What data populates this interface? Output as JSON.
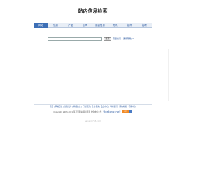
{
  "page": {
    "title": "站内信息检索"
  },
  "nav": {
    "items": [
      {
        "label": "网站",
        "active": true
      },
      {
        "label": "信息",
        "active": false
      },
      {
        "label": "产品",
        "active": false
      },
      {
        "label": "公司",
        "active": false
      },
      {
        "label": "展会信息",
        "active": false
      },
      {
        "label": "资讯",
        "active": false
      },
      {
        "label": "招商",
        "active": false
      },
      {
        "label": "招聘",
        "active": false
      }
    ]
  },
  "search": {
    "value": "",
    "placeholder": "",
    "button_label": "搜索",
    "advanced_link": "高级搜索 | 使用帮助 >"
  },
  "footer": {
    "links": [
      "首页",
      "网站目录",
      "信息发布",
      "精品信息",
      "行业服务",
      "企业名录",
      "会员中心",
      "联系我们",
      "网站地图",
      "帮助中心"
    ],
    "copyright": "Copyright 2003-2021 某某某网站 版权所有 增值电信业务",
    "icp": "浙ICP备17021713号",
    "badge_label": "ICP"
  },
  "watermark": {
    "text": "hainan0755.com"
  },
  "colors": {
    "nav_active_bg": "#3d6fb6",
    "link": "#1f4f9a",
    "badge_orange": "#f28c28"
  }
}
